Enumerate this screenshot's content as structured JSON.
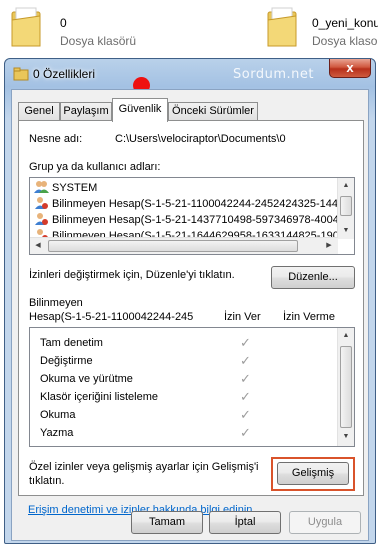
{
  "explorer": {
    "items": [
      {
        "name": "0",
        "type": "Dosya klasörü"
      },
      {
        "name": "0_yeni_konu",
        "type": "Dosya klaso"
      }
    ]
  },
  "window": {
    "title": "0 Özellikleri",
    "close_label": "x",
    "watermark": "Sordum.net"
  },
  "tabs": [
    {
      "label": "Genel",
      "active": false
    },
    {
      "label": "Paylaşım",
      "active": false
    },
    {
      "label": "Güvenlik",
      "active": true
    },
    {
      "label": "Önceki Sürümler",
      "active": false
    }
  ],
  "security": {
    "object_label": "Nesne adı:",
    "object_value": "C:\\Users\\velociraptor\\Documents\\0",
    "groups_label": "Grup ya da kullanıcı adları:",
    "groups": [
      {
        "name": "SYSTEM",
        "icon": "group-users-icon"
      },
      {
        "name": "Bilinmeyen Hesap(S-1-5-21-1100042244-2452424325-1447",
        "icon": "unknown-user-icon"
      },
      {
        "name": "Bilinmeyen Hesap(S-1-5-21-1437710498-597346978-40042",
        "icon": "unknown-user-icon"
      },
      {
        "name": "Bilinmeyen Hesap(S-1-5-21-1644629958-1633144825-1907",
        "icon": "unknown-user-icon"
      }
    ],
    "edit_hint": "İzinleri değiştirmek için, Düzenle'yi tıklatın.",
    "edit_button": "Düzenle...",
    "perm_for_line1": "Bilinmeyen",
    "perm_for_line2": "Hesap(S-1-5-21-1100042244-245",
    "allow_header": "İzin Ver",
    "deny_header": "İzin Verme",
    "permissions": [
      {
        "name": "Tam denetim",
        "allow": true,
        "deny": false
      },
      {
        "name": "Değiştirme",
        "allow": true,
        "deny": false
      },
      {
        "name": "Okuma ve yürütme",
        "allow": true,
        "deny": false
      },
      {
        "name": "Klasör içeriğini listeleme",
        "allow": true,
        "deny": false
      },
      {
        "name": "Okuma",
        "allow": true,
        "deny": false
      },
      {
        "name": "Yazma",
        "allow": true,
        "deny": false
      }
    ],
    "check_glyph": "✓",
    "advanced_hint_line1": "Özel izinler veya gelişmiş ayarlar için Gelişmiş'i",
    "advanced_hint_line2": "tıklatın.",
    "advanced_button": "Gelişmiş",
    "link": "Erişim denetimi ve izinler hakkında bilgi edinin"
  },
  "footer": {
    "ok": "Tamam",
    "cancel": "İptal",
    "apply": "Uygula"
  },
  "colors": {
    "highlight": "#d9532b",
    "link": "#0066cc",
    "red_dot": "#ee1111"
  }
}
